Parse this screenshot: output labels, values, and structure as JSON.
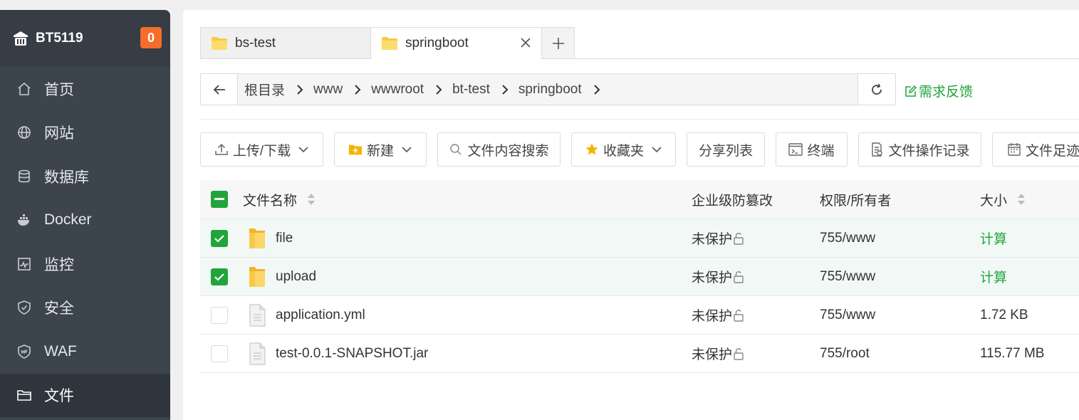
{
  "brand": {
    "name": "BT5119",
    "badge": "0"
  },
  "sidebar": {
    "items": [
      {
        "label": "首页",
        "icon": "home-icon"
      },
      {
        "label": "网站",
        "icon": "globe-icon"
      },
      {
        "label": "数据库",
        "icon": "database-icon"
      },
      {
        "label": "Docker",
        "icon": "docker-icon"
      },
      {
        "label": "监控",
        "icon": "monitor-icon"
      },
      {
        "label": "安全",
        "icon": "shield-icon"
      },
      {
        "label": "WAF",
        "icon": "waf-icon"
      },
      {
        "label": "文件",
        "icon": "folder-icon",
        "active": true
      }
    ]
  },
  "tabs": [
    {
      "label": "bs-test"
    },
    {
      "label": "springboot"
    }
  ],
  "path": {
    "crumbs": [
      "根目录",
      "www",
      "wwwroot",
      "bt-test",
      "springboot"
    ],
    "feedback": "需求反馈"
  },
  "toolbar": {
    "upload": "上传/下载",
    "new": "新建",
    "search": "文件内容搜索",
    "favorites": "收藏夹",
    "share": "分享列表",
    "terminal": "终端",
    "oplog": "文件操作记录",
    "footprint": "文件足迹"
  },
  "table": {
    "headers": {
      "name": "文件名称",
      "protect": "企业级防篡改",
      "perm": "权限/所有者",
      "size": "大小"
    },
    "rows": [
      {
        "name": "file",
        "type": "folder",
        "protect": "未保护",
        "perm": "755/www",
        "size": "计算",
        "checked": true
      },
      {
        "name": "upload",
        "type": "folder",
        "protect": "未保护",
        "perm": "755/www",
        "size": "计算",
        "checked": true
      },
      {
        "name": "application.yml",
        "type": "file",
        "protect": "未保护",
        "perm": "755/www",
        "size": "1.72 KB",
        "checked": false
      },
      {
        "name": "test-0.0.1-SNAPSHOT.jar",
        "type": "file",
        "protect": "未保护",
        "perm": "755/root",
        "size": "115.77 MB",
        "checked": false
      }
    ]
  },
  "colors": {
    "accent": "#20a53a",
    "badge": "#f56c2c",
    "sidebar": "#3c444d"
  }
}
